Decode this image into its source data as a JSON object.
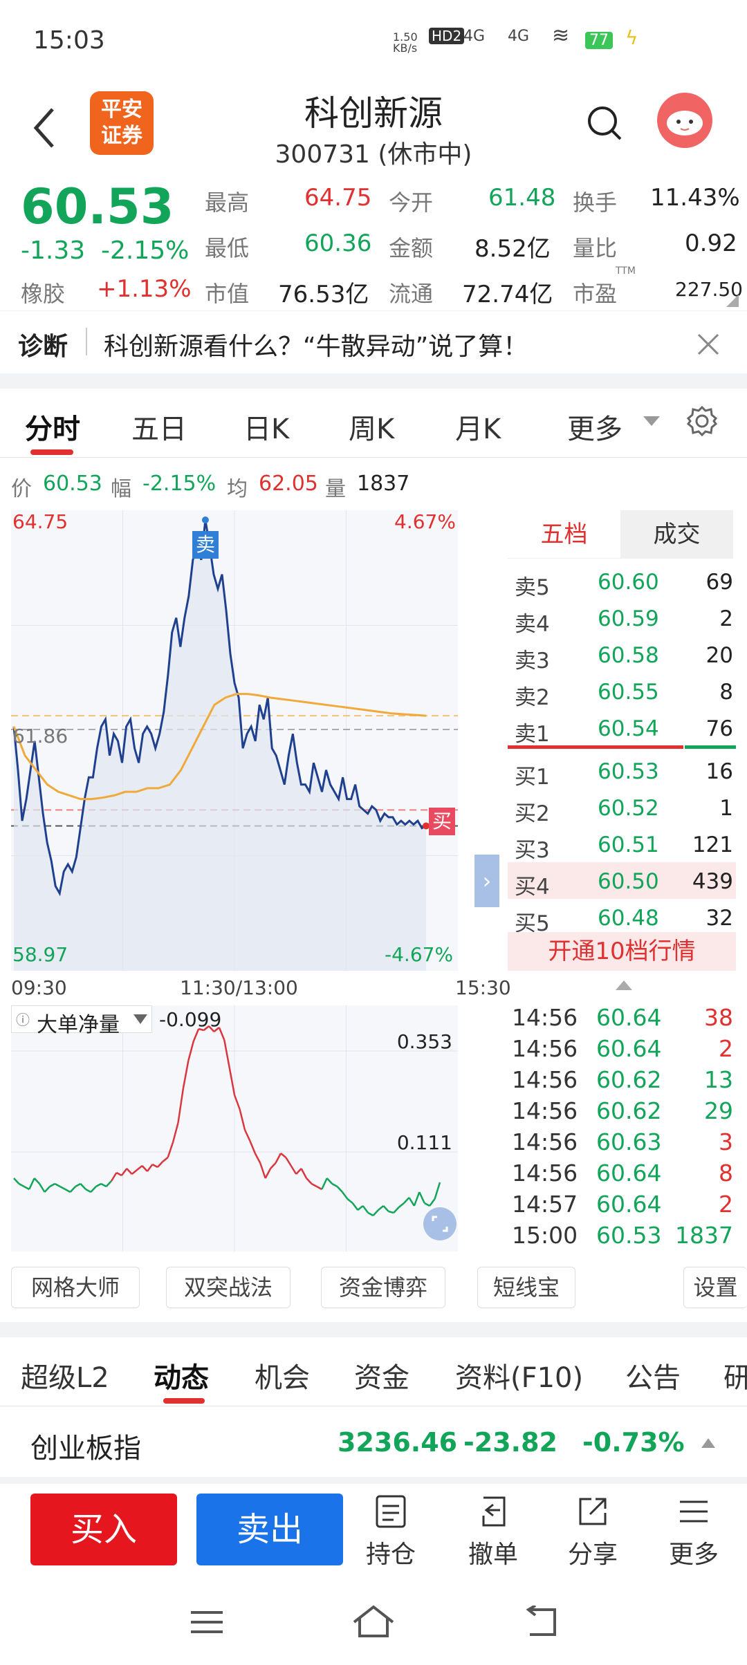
{
  "status": {
    "time": "15:03",
    "net_speed": "1.50 KB/s",
    "hd": "HD2",
    "sig1": "4G",
    "sig2": "4G",
    "battery": "77"
  },
  "header": {
    "logo": "平安证券",
    "title": "科创新源",
    "subtitle": "300731 (休市中)"
  },
  "quote": {
    "price": "60.53",
    "change": "-1.33",
    "pct": "-2.15%",
    "sector_name": "橡胶",
    "sector_pct": "+1.13%",
    "high_label": "最高",
    "high": "64.75",
    "open_label": "今开",
    "open": "61.48",
    "turnover_label": "换手",
    "turnover": "11.43%",
    "low_label": "最低",
    "low": "60.36",
    "amount_label": "金额",
    "amount": "8.52亿",
    "vol_ratio_label": "量比",
    "vol_ratio": "0.92",
    "mktcap_label": "市值",
    "mktcap": "76.53亿",
    "float_label": "流通",
    "float": "72.74亿",
    "pe_label": "市盈",
    "pe_sup": "TTM",
    "pe": "227.50"
  },
  "diagnosis": {
    "label": "诊断",
    "text": "科创新源看什么？“牛散异动”说了算！"
  },
  "tabs": [
    "分时",
    "五日",
    "日K",
    "周K",
    "月K",
    "更多"
  ],
  "info": {
    "price_label": "价",
    "price": "60.53",
    "amp_label": "幅",
    "amp": "-2.15%",
    "avg_label": "均",
    "avg": "62.05",
    "vol_label": "量",
    "vol": "1837"
  },
  "chart_labels": {
    "top_left": "64.75",
    "top_right": "4.67%",
    "mid": "61.86",
    "bottom_left": "58.97",
    "bottom_right": "-4.67%",
    "sell_marker": "卖",
    "buy_marker": "买"
  },
  "chart_data": {
    "type": "line",
    "title": "",
    "x_ticks": [
      "09:30",
      "11:30/13:00",
      "15:30"
    ],
    "ylim": [
      58.97,
      64.75
    ],
    "pre_close": 61.86,
    "series": [
      {
        "values": [
          61.9,
          61.3,
          60.6,
          60.9,
          61.3,
          61.7,
          61.2,
          60.7,
          60.3,
          60.05,
          59.7,
          59.6,
          59.9,
          60.0,
          59.9,
          60.1,
          60.5,
          60.9,
          61.2,
          61.2,
          61.6,
          61.9,
          62.0,
          61.5,
          61.8,
          61.7,
          61.4,
          61.9,
          62.0,
          61.6,
          61.4,
          61.8,
          61.9,
          61.8,
          61.6,
          61.8,
          62.1,
          62.6,
          63.2,
          63.4,
          63.0,
          63.4,
          63.7,
          64.2,
          64.4,
          64.2,
          64.75,
          64.4,
          64.0,
          63.8,
          64.0,
          63.5,
          62.9,
          62.5,
          62.3,
          61.6,
          61.8,
          61.9,
          61.7,
          62.2,
          62.0,
          62.3,
          61.6,
          61.5,
          61.3,
          61.1,
          61.5,
          61.8,
          61.4,
          61.1,
          61.1,
          61.0,
          61.4,
          61.2,
          61.0,
          61.3,
          61.1,
          61.0,
          60.9,
          61.2,
          60.9,
          60.9,
          61.1,
          60.8,
          60.75,
          60.7,
          60.8,
          60.75,
          60.6,
          60.7,
          60.65,
          60.65,
          60.55,
          60.6,
          60.55,
          60.6,
          60.55,
          60.6,
          60.5,
          60.53
        ]
      },
      {
        "values": [
          61.9,
          61.5,
          61.3,
          61.1,
          61.0,
          60.95,
          60.9,
          60.9,
          60.92,
          60.95,
          61.0,
          61.0,
          61.05,
          61.05,
          61.1,
          61.3,
          61.6,
          61.9,
          62.2,
          62.3,
          62.35,
          62.35,
          62.33,
          62.3,
          62.28,
          62.26,
          62.24,
          62.22,
          62.2,
          62.18,
          62.16,
          62.14,
          62.12,
          62.1,
          62.08,
          62.07,
          62.06,
          62.05
        ]
      }
    ],
    "lower": {
      "name": "大单净量",
      "value": "-0.099",
      "ticks": [
        "0.353",
        "0.111"
      ]
    }
  },
  "book": {
    "tab1": "五档",
    "tab2": "成交",
    "asks": [
      {
        "label": "卖5",
        "price": "60.60",
        "vol": "69"
      },
      {
        "label": "卖4",
        "price": "60.59",
        "vol": "2"
      },
      {
        "label": "卖3",
        "price": "60.58",
        "vol": "20"
      },
      {
        "label": "卖2",
        "price": "60.55",
        "vol": "8"
      },
      {
        "label": "卖1",
        "price": "60.54",
        "vol": "76"
      }
    ],
    "bids": [
      {
        "label": "买1",
        "price": "60.53",
        "vol": "16"
      },
      {
        "label": "买2",
        "price": "60.52",
        "vol": "1"
      },
      {
        "label": "买3",
        "price": "60.51",
        "vol": "121"
      },
      {
        "label": "买4",
        "price": "60.50",
        "vol": "439"
      },
      {
        "label": "买5",
        "price": "60.48",
        "vol": "32"
      }
    ],
    "open10": "开通10档行情"
  },
  "trades": [
    {
      "t": "14:56",
      "p": "60.64",
      "v": "38"
    },
    {
      "t": "14:56",
      "p": "60.64",
      "v": "2"
    },
    {
      "t": "14:56",
      "p": "60.62",
      "v": "13"
    },
    {
      "t": "14:56",
      "p": "60.62",
      "v": "29"
    },
    {
      "t": "14:56",
      "p": "60.63",
      "v": "3"
    },
    {
      "t": "14:56",
      "p": "60.64",
      "v": "8"
    },
    {
      "t": "14:57",
      "p": "60.64",
      "v": "2"
    },
    {
      "t": "15:00",
      "p": "60.53",
      "v": "1837"
    }
  ],
  "tools": [
    "网格大师",
    "双突战法",
    "资金博弈",
    "短线宝",
    "设置"
  ],
  "tabs2": [
    "超级L2",
    "动态",
    "机会",
    "资金",
    "资料(F10)",
    "公告",
    "研"
  ],
  "index": {
    "name": "创业板指",
    "value": "3236.46",
    "change": "-23.82",
    "pct": "-0.73%"
  },
  "bottom": {
    "buy": "买入",
    "sell": "卖出",
    "hold": "持仓",
    "cancel": "撤单",
    "share": "分享",
    "more": "更多"
  },
  "colors": {
    "up": "#e0302f",
    "down": "#12a55a",
    "brand": "#f0641e",
    "sell_btn": "#1a73e8"
  }
}
